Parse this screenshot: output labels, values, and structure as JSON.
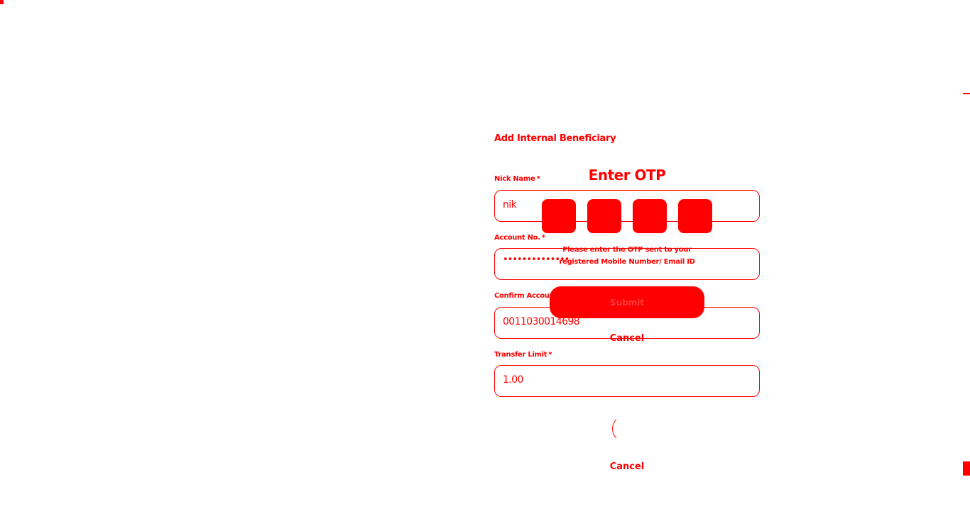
{
  "form": {
    "title": "Add Internal Beneficiary",
    "nick_name": {
      "label": "Nick Name",
      "required_mark": "*",
      "value": "nik"
    },
    "account_no": {
      "label": "Account No.",
      "required_mark": "*",
      "value": "••••••••••••••"
    },
    "confirm_account": {
      "label": "Confirm Account No.",
      "required_mark": "*",
      "value": "0011030014698"
    },
    "transfer_limit": {
      "label": "Transfer Limit",
      "required_mark": "*",
      "value": "1.00"
    },
    "cancel_label": "Cancel"
  },
  "otp_dialog": {
    "title": "Enter OTP",
    "message_line1": "Please enter the OTP sent to your",
    "message_line2": "registered Mobile Number/ Email ID",
    "submit_label": "Submit",
    "cancel_label": "Cancel",
    "digit_count": 4
  },
  "colors": {
    "accent": "#ff0000",
    "background": "#ffffff"
  }
}
